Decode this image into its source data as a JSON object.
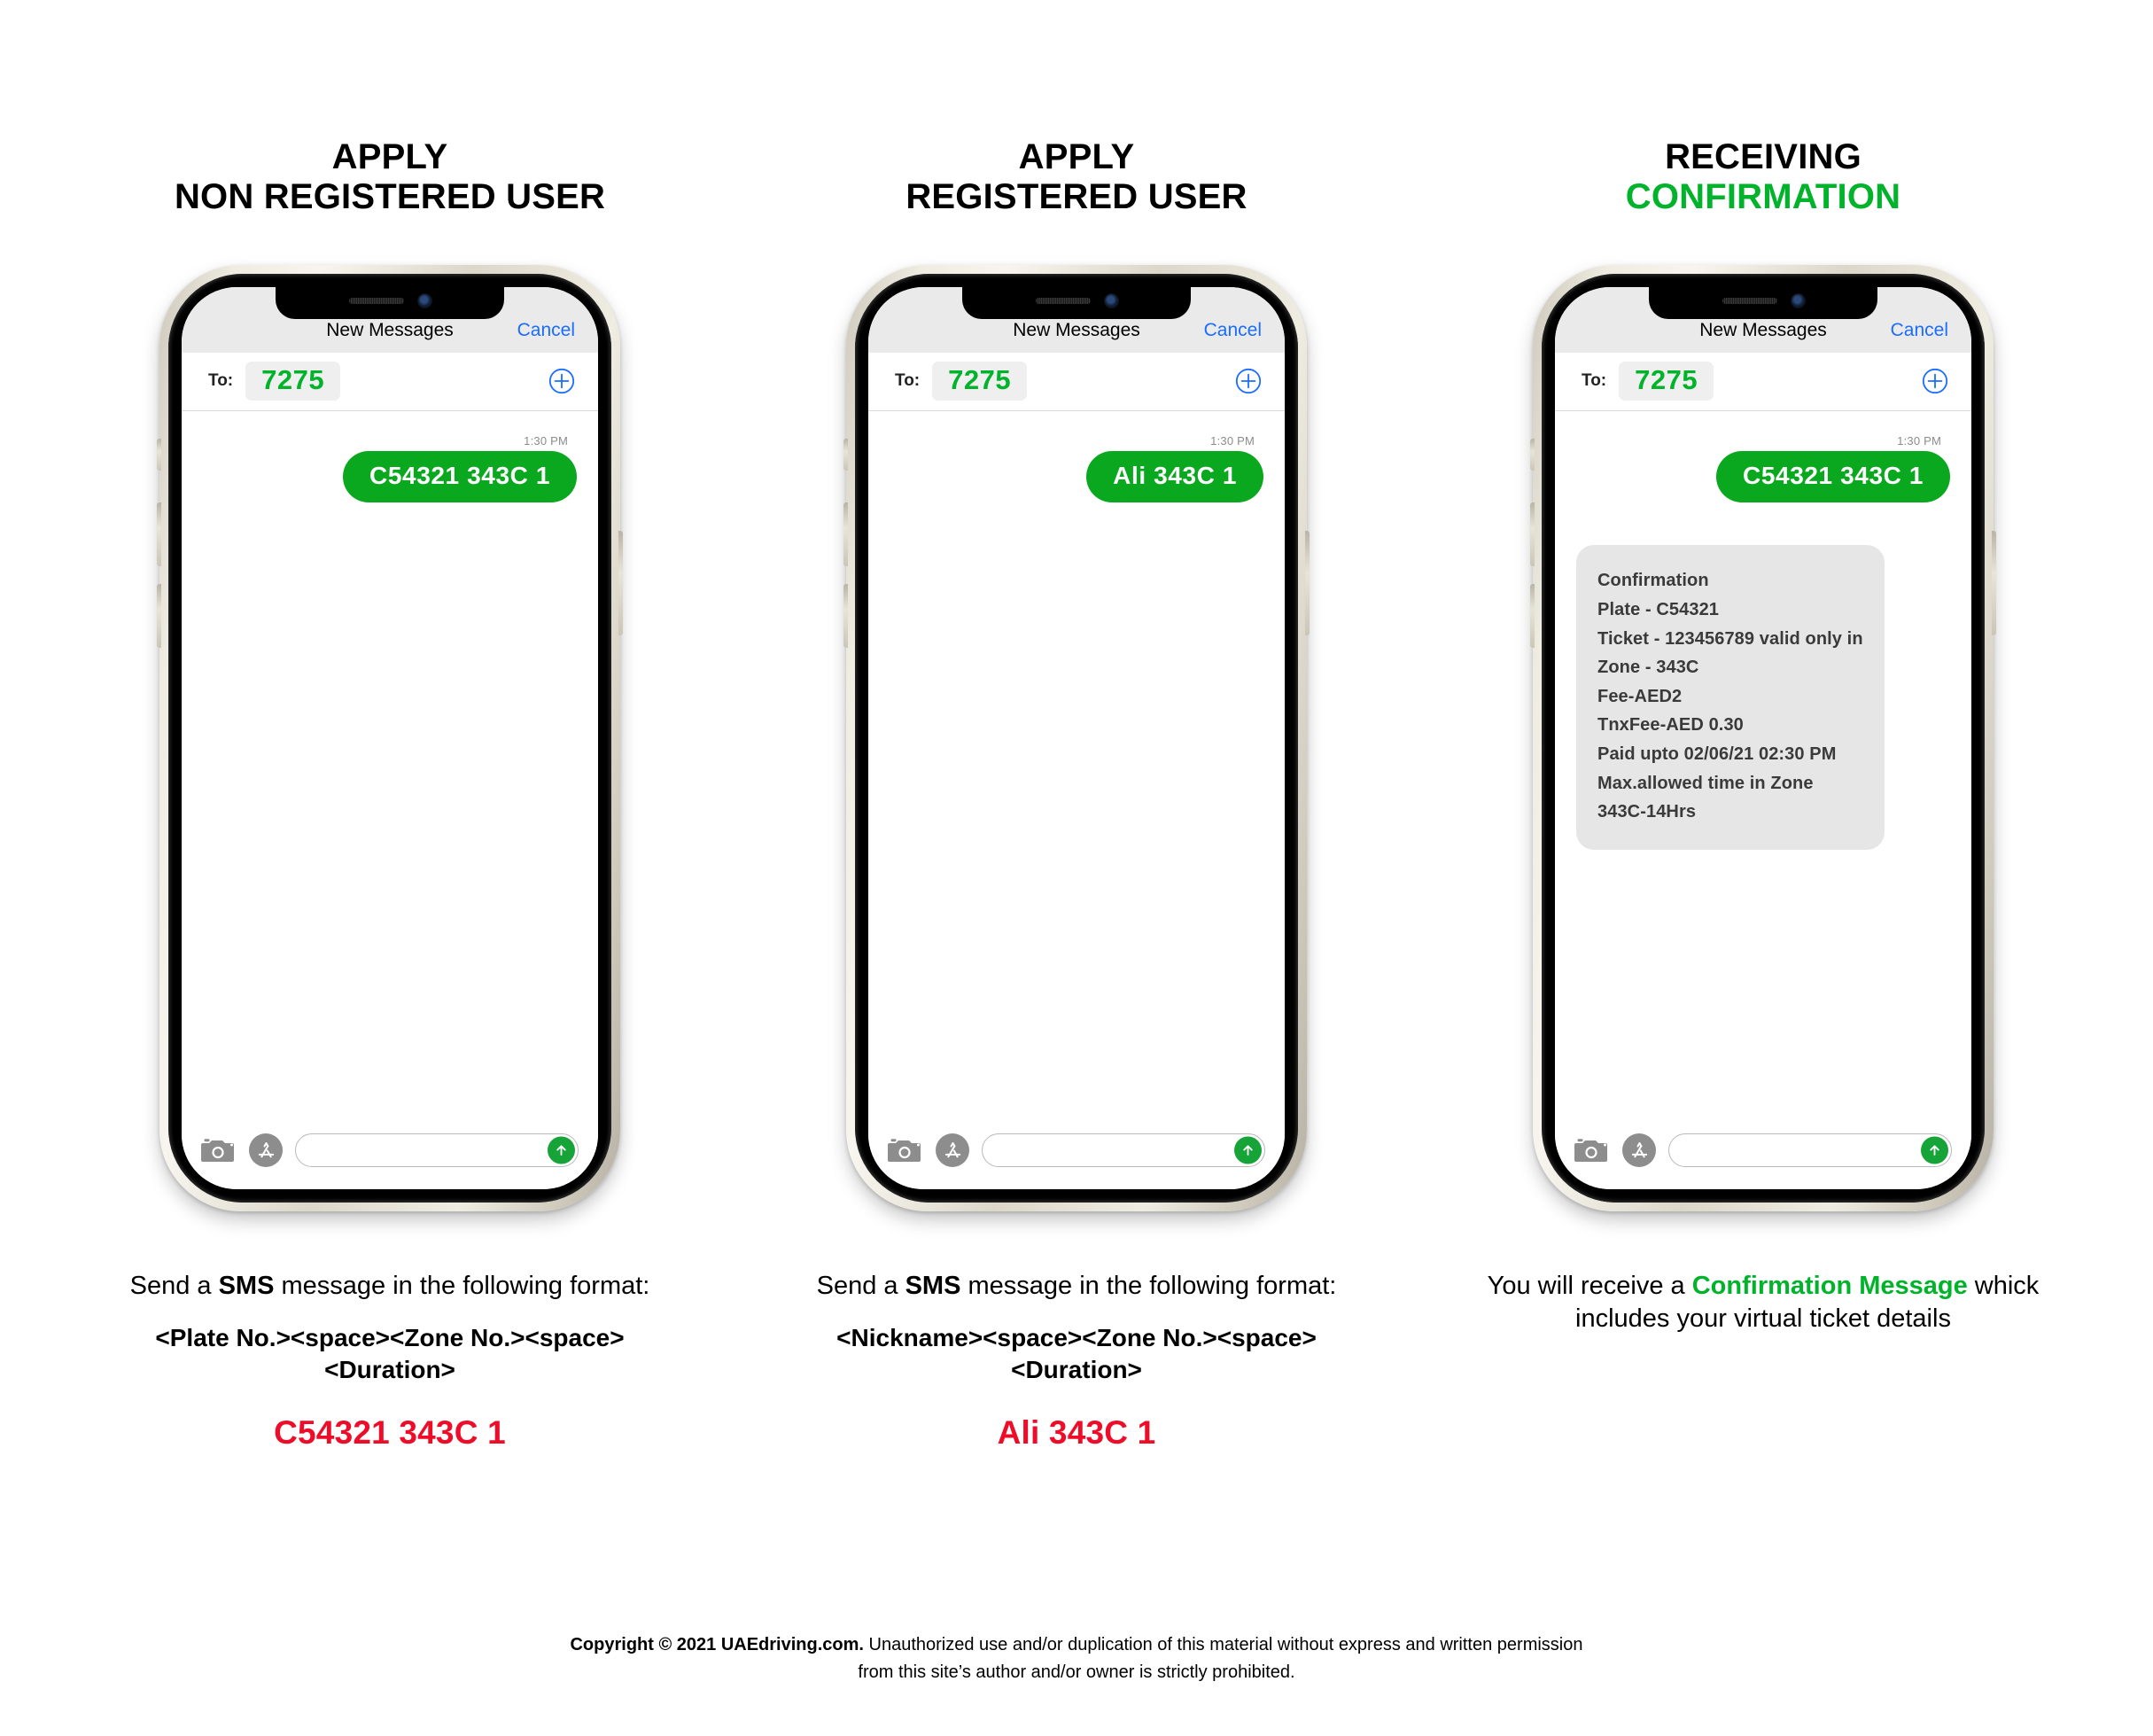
{
  "columns": [
    {
      "heading_line1": "APPLY",
      "heading_line2": "NON REGISTERED USER",
      "heading_line2_color": "#000000",
      "phone": {
        "nav_title": "New Messages",
        "nav_cancel": "Cancel",
        "to_label": "To:",
        "to_value": "7275",
        "message_time": "1:30 PM",
        "outgoing_message": "C54321 343C 1",
        "incoming_message_lines": []
      },
      "caption": {
        "intro_before": "Send a ",
        "intro_bold": "SMS",
        "intro_after": " message in the following format:",
        "format": "<Plate No.><space><Zone No.><space><Duration>",
        "example": "C54321 343C 1"
      }
    },
    {
      "heading_line1": "APPLY",
      "heading_line2": "REGISTERED USER",
      "heading_line2_color": "#000000",
      "phone": {
        "nav_title": "New Messages",
        "nav_cancel": "Cancel",
        "to_label": "To:",
        "to_value": "7275",
        "message_time": "1:30 PM",
        "outgoing_message": "Ali 343C 1",
        "incoming_message_lines": []
      },
      "caption": {
        "intro_before": "Send a ",
        "intro_bold": "SMS",
        "intro_after": " message in the following format:",
        "format": "<Nickname><space><Zone No.><space><Duration>",
        "example": "Ali 343C 1"
      }
    },
    {
      "heading_line1": "RECEIVING",
      "heading_line2": "CONFIRMATION",
      "heading_line2_color": "#00b32a",
      "phone": {
        "nav_title": "New Messages",
        "nav_cancel": "Cancel",
        "to_label": "To:",
        "to_value": "7275",
        "message_time": "1:30 PM",
        "outgoing_message": "C54321 343C 1",
        "incoming_message_lines": [
          "Confirmation",
          "Plate - C54321",
          "Ticket - 123456789 valid only in",
          "Zone - 343C",
          "Fee-AED2",
          "TnxFee-AED 0.30",
          "Paid upto 02/06/21 02:30 PM",
          "Max.allowed time in Zone",
          "343C-14Hrs"
        ]
      },
      "caption": {
        "confirm_before": "You will receive a ",
        "confirm_green": "Confirmation Message",
        "confirm_after": " whick includes your virtual ticket details"
      }
    }
  ],
  "footer": {
    "bold_part": "Copyright © 2021 UAEdriving.com.",
    "rest_line1": " Unauthorized use and/or duplication of this material without express and written permission",
    "line2": "from this site’s author and/or owner is strictly prohibited."
  },
  "icons": {
    "camera": "camera-icon",
    "appstore": "app-store-icon",
    "send": "send-arrow-icon",
    "plus": "plus-circle-icon"
  },
  "colors": {
    "green_accent": "#00b32a",
    "bubble_green": "#0aa81e",
    "red_example": "#ee0c28",
    "link_blue": "#1a6dff"
  }
}
